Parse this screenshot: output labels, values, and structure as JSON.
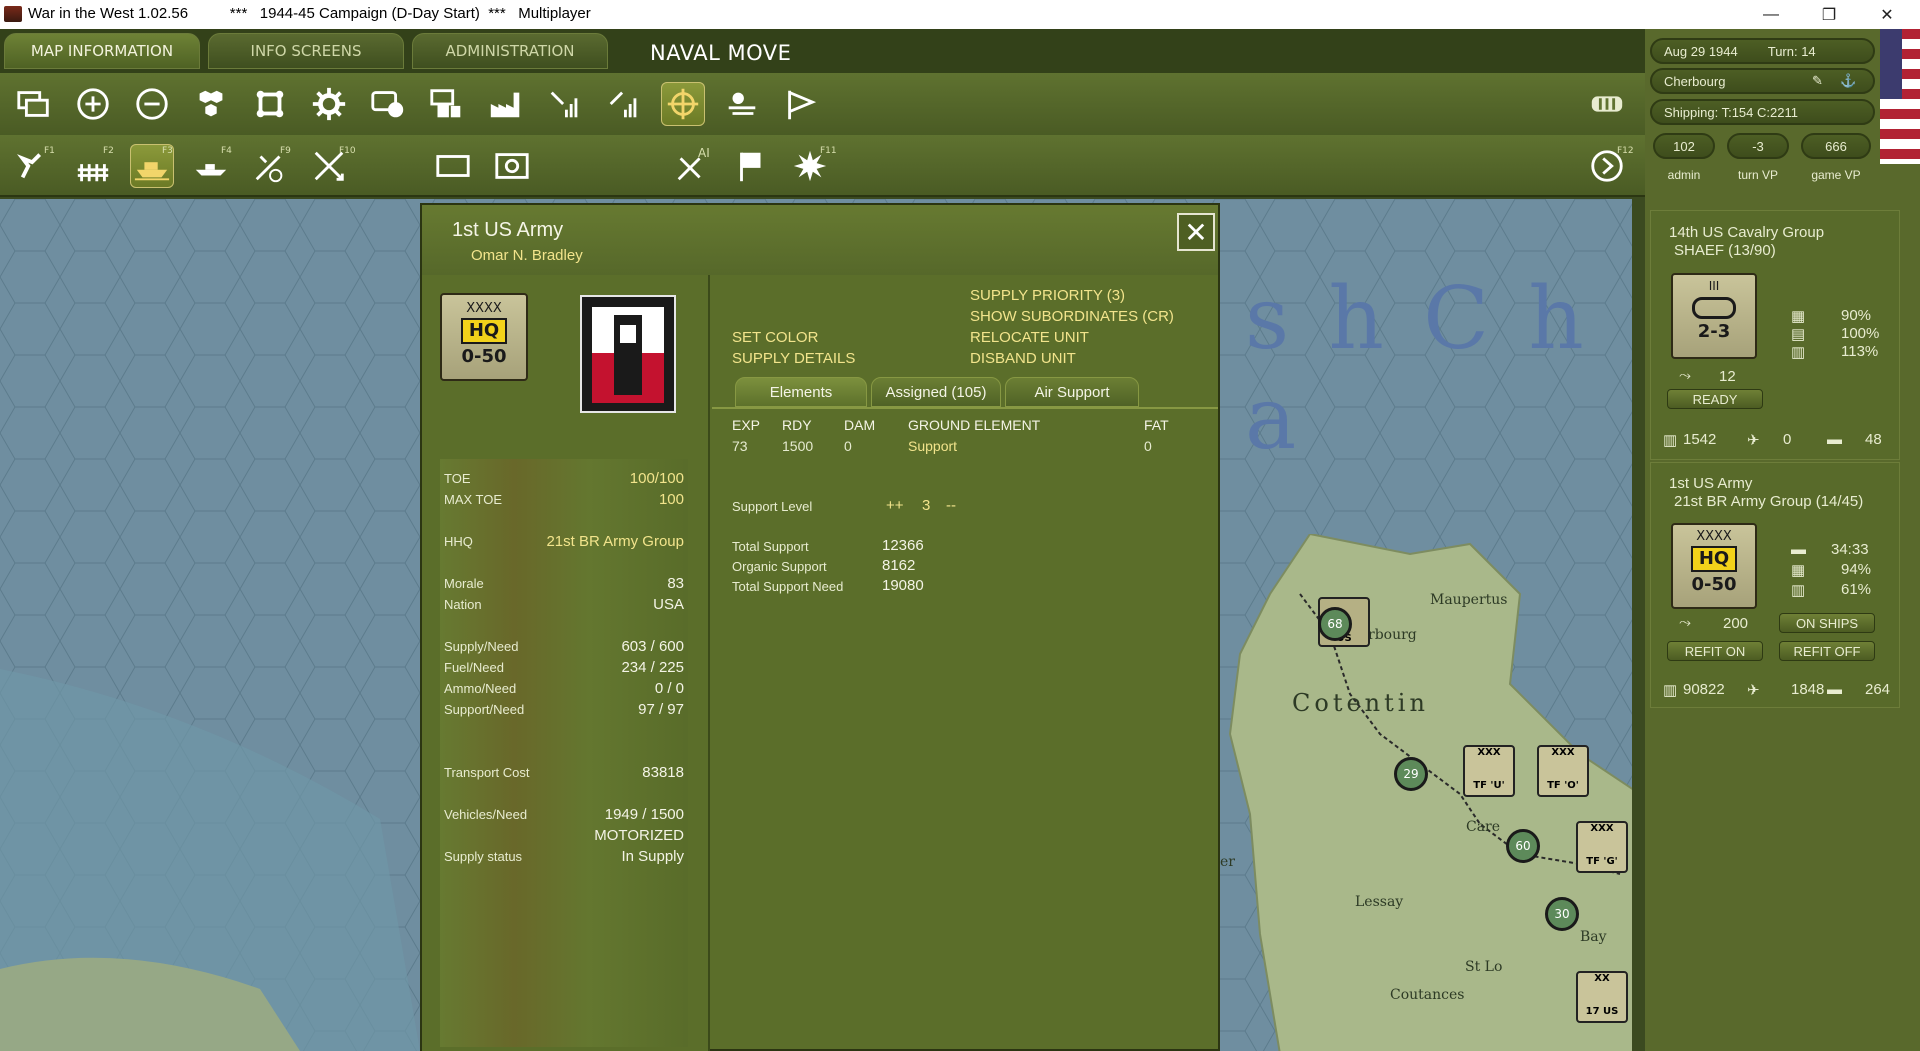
{
  "window": {
    "app_title": "War in the West 1.02.56",
    "scenario": "***   1944-45 Campaign (D-Day Start)  ***   Multiplayer",
    "minimize": "—",
    "restore": "❐",
    "close": "✕"
  },
  "tabs": [
    {
      "label": "MAP INFORMATION",
      "active": true
    },
    {
      "label": "INFO SCREENS",
      "active": false
    },
    {
      "label": "ADMINISTRATION",
      "active": false
    }
  ],
  "mode_label": "NAVAL MOVE",
  "toolbar_keys": {
    "f1": "F1",
    "f2": "F2",
    "f3": "F3",
    "f4": "F4",
    "f9": "F9",
    "f10": "F10",
    "ai": "AI",
    "f11": "F11",
    "f12": "F12"
  },
  "status": {
    "date": "Aug 29 1944",
    "turn": "Turn: 14",
    "location": "Cherbourg",
    "shipping": "Shipping:  T:154  C:2211",
    "admin_value": "102",
    "turn_vp_value": "-3",
    "game_vp_value": "666",
    "admin_label": "admin",
    "turn_vp_label": "turn VP",
    "game_vp_label": "game VP"
  },
  "unit_cards": [
    {
      "name": "14th US Cavalry Group",
      "parent": "SHAEF  (13/90)",
      "size": "III",
      "strength": "2-3",
      "move": "12",
      "pct1": "90%",
      "pct2": "100%",
      "pct3": "113%",
      "status_btn": "READY",
      "men": "1542",
      "planes": "0",
      "tanks": "48"
    },
    {
      "name": "1st US Army",
      "parent": "21st BR Army Group (14/45)",
      "size": "XXXX",
      "badge": "HQ",
      "strength": "0-50",
      "move": "200",
      "stat1": "34:33",
      "pct2": "94%",
      "pct3": "61%",
      "ships_btn": "ON SHIPS",
      "refit_on": "REFIT ON",
      "refit_off": "REFIT OFF",
      "men": "90822",
      "planes": "1848",
      "tanks": "264"
    }
  ],
  "dialog": {
    "title": "1st US Army",
    "commander": "Omar N. Bradley",
    "counter": {
      "size": "XXXX",
      "badge": "HQ",
      "strength": "0-50"
    },
    "close": "✕",
    "stats": {
      "toe_label": "TOE",
      "toe": "100/100",
      "max_toe_label": "MAX TOE",
      "max_toe": "100",
      "hhq_label": "HHQ",
      "hhq": "21st BR Army Group",
      "morale_label": "Morale",
      "morale": "83",
      "nation_label": "Nation",
      "nation": "USA",
      "supply_label": "Supply/Need",
      "supply": "603 / 600",
      "fuel_label": "Fuel/Need",
      "fuel": "234 / 225",
      "ammo_label": "Ammo/Need",
      "ammo": "0 / 0",
      "support_label": "Support/Need",
      "support": "97 / 97",
      "transport_label": "Transport Cost",
      "transport": "83818",
      "vehicles_label": "Vehicles/Need",
      "vehicles": "1949 / 1500",
      "motorized": "MOTORIZED",
      "supply_status_label": "Supply status",
      "supply_status": "In Supply"
    },
    "actions": {
      "supply_priority": "SUPPLY PRIORITY (3)",
      "show_subordinates": "SHOW SUBORDINATES (CR)",
      "set_color": "SET COLOR",
      "relocate": "RELOCATE UNIT",
      "supply_details": "SUPPLY DETAILS",
      "disband": "DISBAND UNIT"
    },
    "sub_tabs": [
      {
        "label": "Elements",
        "active": true
      },
      {
        "label": "Assigned (105)",
        "active": false
      },
      {
        "label": "Air Support",
        "active": false
      }
    ],
    "element_columns": [
      "EXP",
      "RDY",
      "DAM",
      "GROUND ELEMENT",
      "FAT"
    ],
    "element_rows": [
      {
        "exp": "73",
        "rdy": "1500",
        "dam": "0",
        "element": "Support",
        "fat": "0"
      }
    ],
    "support": {
      "level_label": "Support Level",
      "plus": "++",
      "level": "3",
      "minus": "--",
      "total_label": "Total Support",
      "total": "12366",
      "organic_label": "Organic Support",
      "organic": "8162",
      "need_label": "Total Support Need",
      "need": "19080"
    }
  },
  "map": {
    "sea_label": "s h   C h a",
    "cotentin": "Cotentin",
    "cherbourg": "rbourg",
    "maupertus": "Maupertus",
    "lessay": "Lessay",
    "st_lo": "St Lo",
    "coutances": "Coutances",
    "carentan": "Care",
    "bayeux": "Bay",
    "er": "er",
    "hq_label_1": "US",
    "ring_1": "68",
    "ring_2": "29",
    "ring_3": "60",
    "ring_4": "30",
    "tf_u": "TF 'U'",
    "tf_o": "TF 'O'",
    "tf_g": "TF 'G'",
    "div_17": "17 US",
    "xxx": "XXX",
    "xx": "XX"
  }
}
